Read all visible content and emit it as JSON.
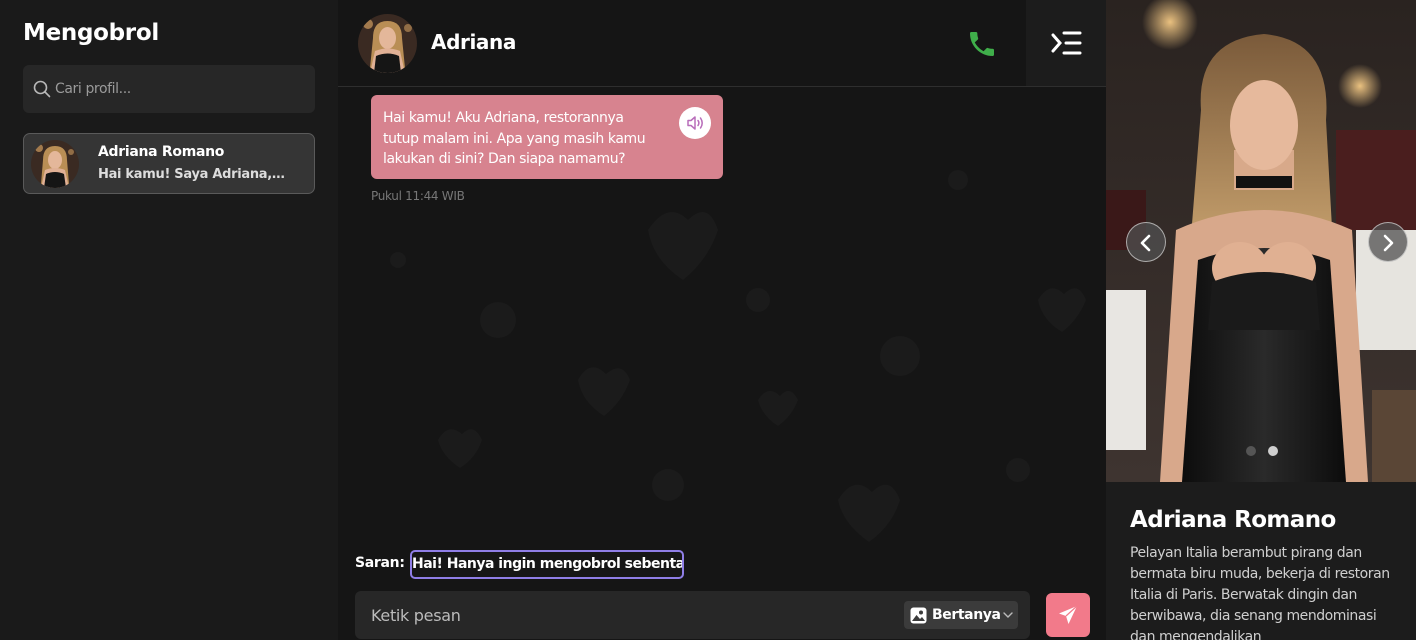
{
  "sidebar": {
    "title": "Mengobrol",
    "search_placeholder": "Cari profil...",
    "contacts": [
      {
        "name": "Adriana Romano",
        "preview": "Hai kamu! Saya Adriana, restorannya tutup malam ini."
      }
    ]
  },
  "chat": {
    "name": "Adriana",
    "messages": [
      {
        "text": "Hai kamu! Aku Adriana, restorannya tutup malam ini. Apa yang masih kamu lakukan di sini? Dan siapa namamu?",
        "time": "Pukul 11:44 WIB"
      }
    ],
    "suggestion_label": "Saran:",
    "suggestion": "Hai! Hanya ingin mengobrol sebentar",
    "input_placeholder": "Ketik pesan",
    "mode": "Bertanya"
  },
  "profile": {
    "name": "Adriana Romano",
    "description": "Pelayan Italia berambut pirang dan bermata biru muda, bekerja di restoran Italia di Paris. Berwatak dingin dan berwibawa, dia senang mendominasi dan mengendalikan",
    "photo_count": 2,
    "active_photo": 2
  },
  "colors": {
    "bubble": "#d7838f",
    "call": "#3fae4a",
    "send": "#f27a8a",
    "suggestion_border": "#8f7ee6"
  },
  "icons": [
    "search-icon",
    "phone-icon",
    "menu-collapse-icon",
    "speaker-icon",
    "image-icon",
    "chevron-down-icon",
    "send-icon",
    "chevron-left-icon",
    "chevron-right-icon"
  ]
}
